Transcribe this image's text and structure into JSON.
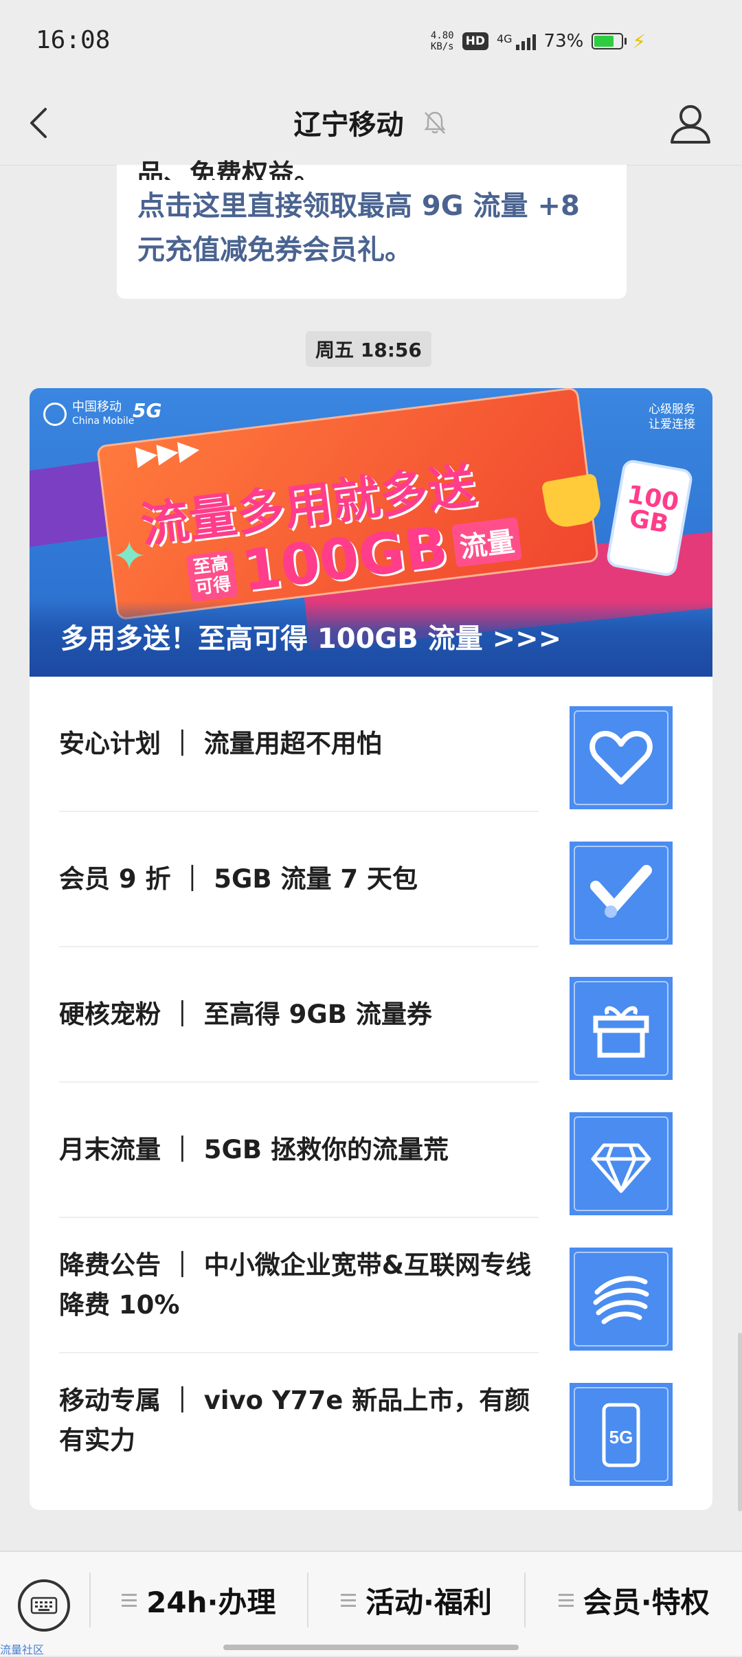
{
  "status_bar": {
    "time": "16:08",
    "speed_value": "4.80",
    "speed_unit": "KB/s",
    "hd": "HD",
    "network": "4G",
    "battery": "73%",
    "battery_level": 0.73,
    "battery_color": "#2ecc40"
  },
  "header": {
    "title": "辽宁移动"
  },
  "prev_message": {
    "partial_line": "品、免费权益。",
    "link_text": "点击这里直接领取最高 9G 流量 +8 元充值减免券会员礼。"
  },
  "timestamp": "周五 18:56",
  "banner": {
    "brand": "中国移动",
    "brand_en": "China Mobile",
    "tag_5g": "5G",
    "service_slogan_1": "心级服务",
    "service_slogan_2": "让爱连接",
    "arrows": "▶▶▶",
    "headline": "流量多用就多送",
    "badge_small_1": "至高",
    "badge_small_2": "可得",
    "badge_big": "100GB",
    "badge_unit": "流量",
    "phone_text_1": "100",
    "phone_text_2": "GB",
    "caption": "多用多送！至高可得 100GB 流量 >>>"
  },
  "items": [
    {
      "text": "安心计划 ｜ 流量用超不用怕",
      "icon": "heart-icon"
    },
    {
      "text": "会员 9 折 ｜ 5GB 流量 7 天包",
      "icon": "check-icon"
    },
    {
      "text": "硬核宠粉 ｜ 至高得 9GB 流量券",
      "icon": "gift-icon"
    },
    {
      "text": "月末流量 ｜ 5GB 拯救你的流量荒",
      "icon": "diamond-icon"
    },
    {
      "text": "降费公告 ｜ 中小微企业宽带&互联网专线降费 10%",
      "icon": "china-mobile-logo-icon"
    },
    {
      "text": "移动专属 ｜ vivo Y77e 新品上市，有颜有实力",
      "icon": "phone-5g-icon"
    }
  ],
  "bottom_menu": {
    "tabs": [
      "24h·办理",
      "活动·福利",
      "会员·特权"
    ]
  },
  "corner_text": "流量社区",
  "colors": {
    "accent_blue": "#4a8cf0",
    "link_blue": "#4a6390",
    "banner_pink": "#ff3d8a"
  }
}
